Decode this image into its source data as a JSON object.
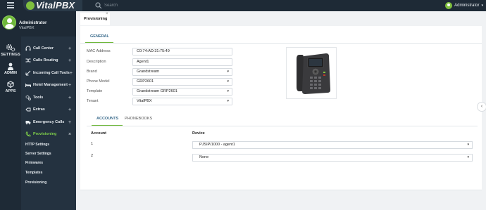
{
  "topbar": {
    "logo_text": "VitalPBX",
    "search_placeholder": "Search",
    "user_label": "Administrator"
  },
  "profile": {
    "name": "Administrator",
    "org": "VitalPBX"
  },
  "rail": {
    "items": [
      {
        "label": "SETTINGS",
        "icon": "gears-icon"
      },
      {
        "label": "ADMIN",
        "icon": "person-icon"
      },
      {
        "label": "APPS",
        "icon": "cubes-icon"
      }
    ]
  },
  "sidebar": {
    "items": [
      {
        "label": "Call Center",
        "icon": "headset-icon",
        "toggle": "+"
      },
      {
        "label": "Calls Routing",
        "icon": "shuffle-icon",
        "toggle": "+"
      },
      {
        "label": "Incoming Call Tools",
        "icon": "incoming-icon",
        "toggle": "+"
      },
      {
        "label": "Hotel Management",
        "icon": "bed-icon",
        "toggle": "+"
      },
      {
        "label": "Tools",
        "icon": "gears-icon",
        "toggle": "+"
      },
      {
        "label": "Extras",
        "icon": "extras-icon",
        "toggle": "+"
      },
      {
        "label": "Emergency Calls",
        "icon": "truck-icon",
        "toggle": "+"
      },
      {
        "label": "Provisioning",
        "icon": "phone-settings-icon",
        "toggle": "×"
      }
    ],
    "sub_items": [
      "HTTP Settings",
      "Server Settings",
      "Firmwares",
      "Templates",
      "Provisioning"
    ]
  },
  "page_tab": {
    "label": "Provisioning",
    "close": "×"
  },
  "general": {
    "tab_label": "GENERAL",
    "fields": [
      {
        "label": "MAC Address",
        "value": "C0:74:AD:31:75:49",
        "type": "input"
      },
      {
        "label": "Description",
        "value": "Agent1",
        "type": "input"
      },
      {
        "label": "Brand",
        "value": "Grandstream",
        "type": "select"
      },
      {
        "label": "Phone Model",
        "value": "GRP2601",
        "type": "select"
      },
      {
        "label": "Template",
        "value": "Grandstream GRP2601",
        "type": "select"
      },
      {
        "label": "Tenant",
        "value": "VitalPBX",
        "type": "select"
      }
    ]
  },
  "tabs": {
    "accounts": "ACCOUNTS",
    "phonebooks": "PHONEBOOKS"
  },
  "accounts_table": {
    "headers": {
      "account": "Account",
      "device": "Device"
    },
    "rows": [
      {
        "account": "1",
        "device": "PJSIP/1000 - agent1"
      },
      {
        "account": "2",
        "device": "None"
      }
    ]
  },
  "colors": {
    "accent_green": "#6fb83b",
    "sidebar_bg": "#243240",
    "topbar_bg": "#1e2a36",
    "tab_blue": "#3a6b8c"
  }
}
